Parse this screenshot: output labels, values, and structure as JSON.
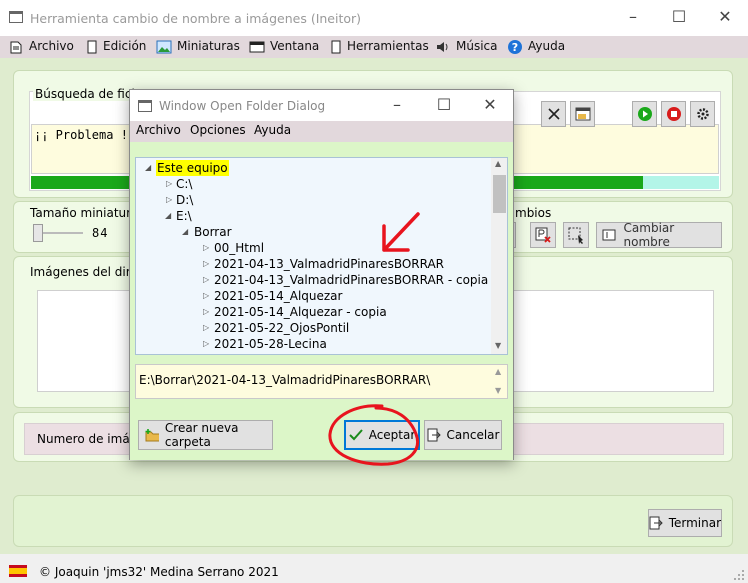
{
  "window": {
    "title": "Herramienta cambio de nombre a imágenes (Ineitor)"
  },
  "menu": {
    "items": [
      {
        "label": "Archivo",
        "icon": "file-menu-icon"
      },
      {
        "label": "Edición",
        "icon": "edit-menu-icon"
      },
      {
        "label": "Miniaturas",
        "icon": "picture-icon"
      },
      {
        "label": "Ventana",
        "icon": "window-icon"
      },
      {
        "label": "Herramientas",
        "icon": "tools-icon"
      },
      {
        "label": "Música",
        "icon": "speaker-icon"
      },
      {
        "label": "Ayuda",
        "icon": "help-icon"
      }
    ]
  },
  "search": {
    "group_label": "Búsqueda de ficheros",
    "problem_text": "¡¡ Problema !"
  },
  "thumbs": {
    "group_label": "Tamaño miniaturas",
    "value": "84"
  },
  "rename": {
    "group_label": "mbios",
    "button_label": "Cambiar nombre"
  },
  "images": {
    "group_label": "Imágenes del direc"
  },
  "count": {
    "label": "Numero de imáge"
  },
  "footer": {
    "button_label": "Terminar"
  },
  "status": {
    "text": "© Joaquin 'jms32' Medina Serrano 2021"
  },
  "progress": {
    "fraction": 0.89
  },
  "dialog": {
    "title": "Window Open Folder Dialog",
    "menu": [
      "Archivo",
      "Opciones",
      "Ayuda"
    ],
    "tree": {
      "root": "Este equipo",
      "drives": [
        "C:\\",
        "D:\\",
        "E:\\"
      ],
      "folder": "Borrar",
      "children": [
        "00_Html",
        "2021-04-13_ValmadridPinaresBORRAR",
        "2021-04-13_ValmadridPinaresBORRAR - copia",
        "2021-05-14_Alquezar",
        "2021-05-14_Alquezar - copia",
        "2021-05-22_OjosPontil",
        "2021-05-28-Lecina"
      ]
    },
    "path": "E:\\Borrar\\2021-04-13_ValmadridPinaresBORRAR\\",
    "new_folder": "Crear nueva carpeta",
    "accept": "Aceptar",
    "cancel": "Cancelar"
  },
  "colors": {
    "menu_bg": "#e2d8dc",
    "panel_bg": "#f0fae6",
    "progress": "#1aa81a",
    "highlight": "#ffff00",
    "annotation": "#e8141e"
  }
}
